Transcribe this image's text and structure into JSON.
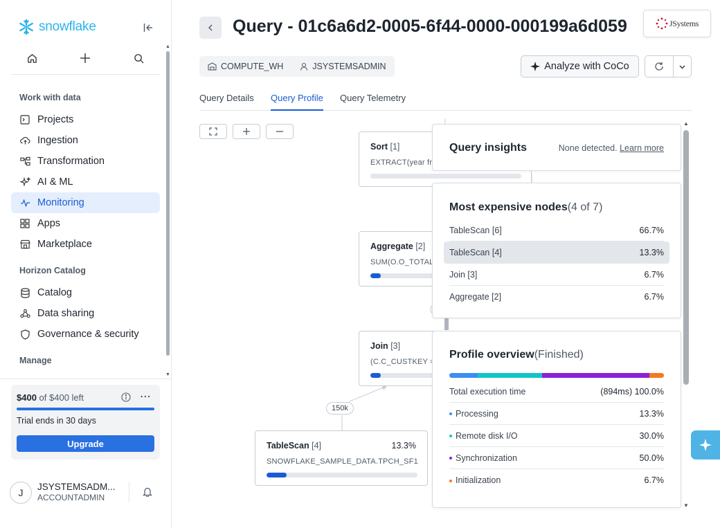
{
  "brand": {
    "name": "snowflake",
    "accent": "#29b5e8",
    "primary": "#2970e1"
  },
  "sidebar": {
    "sections": {
      "work": "Work with data",
      "horizon": "Horizon Catalog",
      "manage": "Manage"
    },
    "items": [
      {
        "label": "Projects",
        "icon": "projects-icon"
      },
      {
        "label": "Ingestion",
        "icon": "cloud-upload-icon"
      },
      {
        "label": "Transformation",
        "icon": "transformation-icon"
      },
      {
        "label": "AI & ML",
        "icon": "sparkle-icon"
      },
      {
        "label": "Monitoring",
        "icon": "activity-icon",
        "active": true
      },
      {
        "label": "Apps",
        "icon": "apps-grid-icon"
      },
      {
        "label": "Marketplace",
        "icon": "storefront-icon"
      },
      {
        "label": "Catalog",
        "icon": "database-icon"
      },
      {
        "label": "Data sharing",
        "icon": "share-icon"
      },
      {
        "label": "Governance & security",
        "icon": "shield-icon"
      }
    ],
    "credits": {
      "amount": "$400",
      "of_total": "of $400 left",
      "trial": "Trial ends in 30 days",
      "upgrade": "Upgrade"
    },
    "user": {
      "initial": "J",
      "name": "JSYSTEMSADM...",
      "role": "ACCOUNTADMIN"
    }
  },
  "header": {
    "title": "Query - 01c6a6d2-0005-6f44-0000-000199a6d059",
    "brand_badge": "JSystems",
    "warehouse": "COMPUTE_WH",
    "user": "JSYSTEMSADMIN",
    "analyze_button": "Analyze with CoCo"
  },
  "tabs": [
    "Query Details",
    "Query Profile",
    "Query Telemetry"
  ],
  "active_tab": "Query Profile",
  "graph": {
    "nodes": [
      {
        "name": "Sort",
        "id": "[1]",
        "desc": "EXTRACT(year fro",
        "pct": "",
        "progress": 0.0
      },
      {
        "name": "Aggregate",
        "id": "[2]",
        "desc": "SUM(O.O_TOTALP",
        "pct": "",
        "progress": 0.067
      },
      {
        "name": "Join",
        "id": "[3]",
        "desc": "(C.C_CUSTKEY =",
        "pct": "",
        "progress": 0.067
      },
      {
        "name": "TableScan",
        "id": "[4]",
        "desc": "SNOWFLAKE_SAMPLE_DATA.TPCH_SF1...",
        "pct": "13.3%",
        "progress": 0.133
      }
    ],
    "edge_label": "150k"
  },
  "insights": {
    "title": "Query insights",
    "none": "None detected.",
    "learn_more": "Learn more"
  },
  "expensive": {
    "title": "Most expensive nodes",
    "count": "(4 of 7)",
    "rows": [
      {
        "name": "TableScan [6]",
        "value": "66.7%"
      },
      {
        "name": "TableScan [4]",
        "value": "13.3%"
      },
      {
        "name": "Join [3]",
        "value": "6.7%"
      },
      {
        "name": "Aggregate [2]",
        "value": "6.7%"
      }
    ]
  },
  "overview": {
    "title": "Profile overview",
    "status": "(Finished)",
    "total_label": "Total execution time",
    "total_value": "(894ms) 100.0%",
    "rows": [
      {
        "name": "Processing",
        "value": "13.3%",
        "color": "#3d8ef0",
        "fraction": 0.133
      },
      {
        "name": "Remote disk I/O",
        "value": "30.0%",
        "color": "#14c4c9",
        "fraction": 0.3
      },
      {
        "name": "Synchronization",
        "value": "50.0%",
        "color": "#8a22d6",
        "fraction": 0.5
      },
      {
        "name": "Initialization",
        "value": "6.7%",
        "color": "#f37a1f",
        "fraction": 0.067
      }
    ]
  }
}
